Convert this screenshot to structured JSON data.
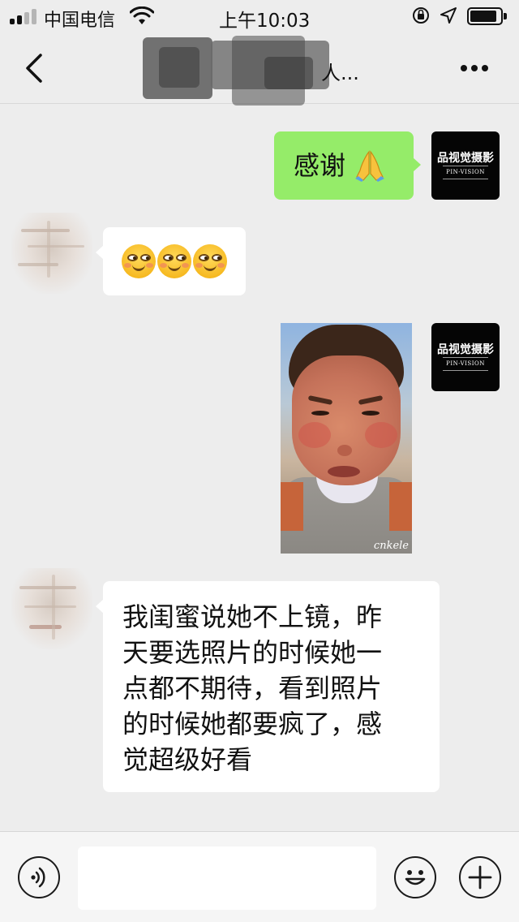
{
  "status_bar": {
    "carrier": "中国电信",
    "time": "上午10:03"
  },
  "nav": {
    "title_visible": "人...",
    "back_icon": "chevron-left-icon",
    "more_icon": "more-dots-icon"
  },
  "brand_avatar": {
    "name_cn": "品视觉摄影",
    "name_en": "PIN-VISION"
  },
  "messages": [
    {
      "side": "right",
      "type": "text",
      "text": "感谢",
      "emoji": "folded-hands-icon"
    },
    {
      "side": "left",
      "type": "emoji",
      "emoji": [
        "smirk-face-icon",
        "smirk-face-icon",
        "smirk-face-icon"
      ]
    },
    {
      "side": "right",
      "type": "image",
      "watermark": "cnkele"
    },
    {
      "side": "left",
      "type": "text",
      "lines": [
        "我闺蜜说她不上镜，昨",
        "天要选照片的时候她一",
        "点都不期待，看到照片",
        "的时候她都要疯了，感",
        "觉超级好看"
      ]
    }
  ],
  "input_bar": {
    "voice_icon": "voice-icon",
    "emoji_icon": "smiley-icon",
    "plus_icon": "plus-icon",
    "input_value": ""
  },
  "colors": {
    "background": "#ededed",
    "my_bubble": "#95ec69",
    "their_bubble": "#ffffff"
  }
}
